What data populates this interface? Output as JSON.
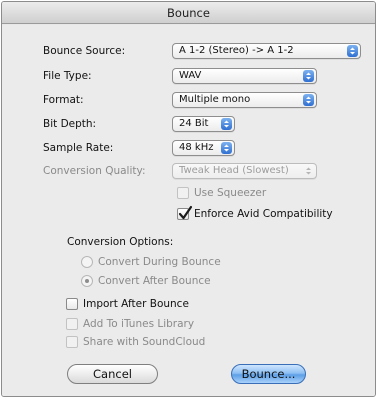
{
  "window": {
    "title": "Bounce"
  },
  "fields": {
    "bounce_source": {
      "label": "Bounce Source:",
      "value": "A 1-2 (Stereo) -> A 1-2"
    },
    "file_type": {
      "label": "File Type:",
      "value": "WAV"
    },
    "format": {
      "label": "Format:",
      "value": "Multiple mono"
    },
    "bit_depth": {
      "label": "Bit Depth:",
      "value": "24 Bit"
    },
    "sample_rate": {
      "label": "Sample Rate:",
      "value": "48 kHz"
    },
    "conversion_quality": {
      "label": "Conversion Quality:",
      "value": "Tweak Head (Slowest)",
      "enabled": false
    }
  },
  "checkboxes": {
    "use_squeezer": {
      "label": "Use Squeezer",
      "checked": false,
      "enabled": false
    },
    "enforce_avid": {
      "label": "Enforce Avid Compatibility",
      "checked": true,
      "enabled": true
    },
    "import_after_bounce": {
      "label": "Import After Bounce",
      "checked": false,
      "enabled": true
    },
    "add_to_itunes": {
      "label": "Add To iTunes Library",
      "checked": false,
      "enabled": false
    },
    "share_soundcloud": {
      "label": "Share with SoundCloud",
      "checked": false,
      "enabled": false
    }
  },
  "conversion_options": {
    "heading": "Conversion Options:",
    "options": [
      {
        "label": "Convert During Bounce",
        "selected": false
      },
      {
        "label": "Convert After Bounce",
        "selected": true
      }
    ]
  },
  "buttons": {
    "cancel": "Cancel",
    "bounce": "Bounce..."
  },
  "colors": {
    "accent": "#3b7fe0",
    "window_bg": "#ebebeb"
  }
}
